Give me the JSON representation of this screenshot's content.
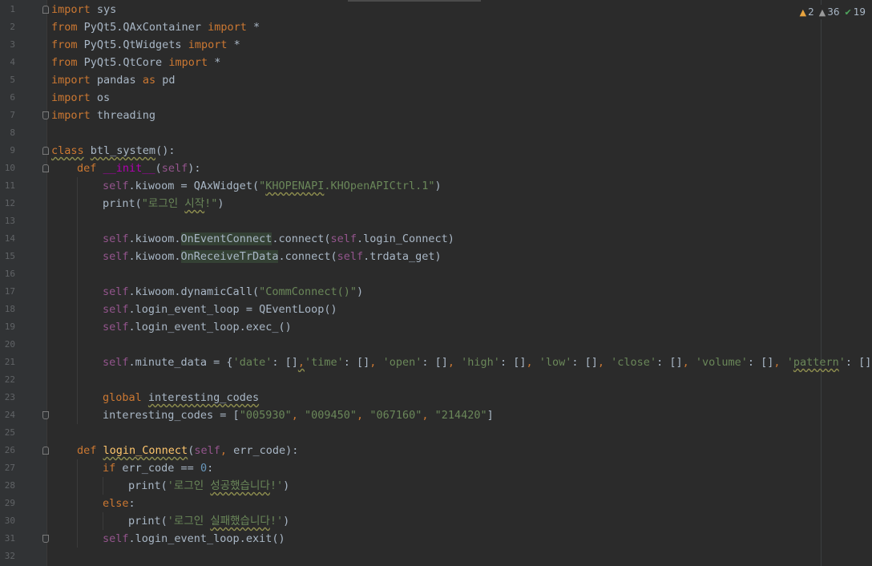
{
  "inspections": {
    "warnings": "2",
    "weak_warnings": "36",
    "typos": "19"
  },
  "colors": {
    "background": "#2b2b2b",
    "keyword": "#cc7832",
    "string": "#6a8759",
    "self": "#94558d",
    "function": "#ffc66d",
    "number": "#6897bb"
  },
  "lines": [
    {
      "n": "1",
      "fold": "start",
      "indent": 0,
      "tokens": [
        [
          "kw",
          "import"
        ],
        [
          "t",
          " sys"
        ]
      ]
    },
    {
      "n": "2",
      "indent": 0,
      "tokens": [
        [
          "kw",
          "from"
        ],
        [
          "t",
          " PyQt5.QAxContainer "
        ],
        [
          "kw",
          "import"
        ],
        [
          "t",
          " *"
        ]
      ]
    },
    {
      "n": "3",
      "indent": 0,
      "tokens": [
        [
          "kw",
          "from"
        ],
        [
          "t",
          " PyQt5.QtWidgets "
        ],
        [
          "kw",
          "import"
        ],
        [
          "t",
          " *"
        ]
      ]
    },
    {
      "n": "4",
      "indent": 0,
      "tokens": [
        [
          "kw",
          "from"
        ],
        [
          "t",
          " PyQt5.QtCore "
        ],
        [
          "kw",
          "import"
        ],
        [
          "t",
          " *"
        ]
      ]
    },
    {
      "n": "5",
      "indent": 0,
      "tokens": [
        [
          "kw",
          "import"
        ],
        [
          "t",
          " pandas "
        ],
        [
          "kw",
          "as"
        ],
        [
          "t",
          " pd"
        ]
      ]
    },
    {
      "n": "6",
      "indent": 0,
      "tokens": [
        [
          "kw",
          "import"
        ],
        [
          "t",
          " os"
        ]
      ]
    },
    {
      "n": "7",
      "fold": "end",
      "indent": 0,
      "tokens": [
        [
          "kw",
          "import"
        ],
        [
          "t",
          " threading"
        ]
      ]
    },
    {
      "n": "8",
      "indent": 0,
      "tokens": []
    },
    {
      "n": "9",
      "fold": "start",
      "indent": 0,
      "tokens": [
        [
          "kw wavy",
          "class"
        ],
        [
          "t",
          " "
        ],
        [
          "t wavy",
          "btl_system"
        ],
        [
          "t",
          "():"
        ]
      ]
    },
    {
      "n": "10",
      "fold": "start",
      "indent": 1,
      "tokens": [
        [
          "kw",
          "def "
        ],
        [
          "mag",
          "__init__"
        ],
        [
          "t",
          "("
        ],
        [
          "slf",
          "self"
        ],
        [
          "t",
          "):"
        ]
      ]
    },
    {
      "n": "11",
      "indent": 2,
      "tokens": [
        [
          "slf",
          "self"
        ],
        [
          "t",
          ".kiwoom = QAxWidget("
        ],
        [
          "str",
          "\""
        ],
        [
          "str wavy",
          "KHOPENAPI"
        ],
        [
          "str",
          ".KHOpenAPICtrl.1\""
        ],
        [
          "t",
          ")"
        ]
      ]
    },
    {
      "n": "12",
      "indent": 2,
      "tokens": [
        [
          "t",
          "print("
        ],
        [
          "str",
          "\"로그인 "
        ],
        [
          "str wavy",
          "시작"
        ],
        [
          "str",
          "!\""
        ],
        [
          "t",
          ")"
        ]
      ]
    },
    {
      "n": "13",
      "indent": 2,
      "tokens": []
    },
    {
      "n": "14",
      "indent": 2,
      "tokens": [
        [
          "slf",
          "self"
        ],
        [
          "t",
          ".kiwoom."
        ],
        [
          "t hl",
          "OnEventConnect"
        ],
        [
          "t",
          ".connect("
        ],
        [
          "slf",
          "self"
        ],
        [
          "t",
          ".login_Connect)"
        ]
      ]
    },
    {
      "n": "15",
      "indent": 2,
      "tokens": [
        [
          "slf",
          "self"
        ],
        [
          "t",
          ".kiwoom."
        ],
        [
          "t hl",
          "OnReceiveTrData"
        ],
        [
          "t",
          ".connect("
        ],
        [
          "slf",
          "self"
        ],
        [
          "t",
          ".trdata_get)"
        ]
      ]
    },
    {
      "n": "16",
      "indent": 2,
      "tokens": []
    },
    {
      "n": "17",
      "indent": 2,
      "tokens": [
        [
          "slf",
          "self"
        ],
        [
          "t",
          ".kiwoom.dynamicCall("
        ],
        [
          "str",
          "\"CommConnect()\""
        ],
        [
          "t",
          ")"
        ]
      ]
    },
    {
      "n": "18",
      "indent": 2,
      "tokens": [
        [
          "slf",
          "self"
        ],
        [
          "t",
          ".login_event_loop = QEventLoop()"
        ]
      ]
    },
    {
      "n": "19",
      "indent": 2,
      "tokens": [
        [
          "slf",
          "self"
        ],
        [
          "t",
          ".login_event_loop.exec_()"
        ]
      ]
    },
    {
      "n": "20",
      "indent": 2,
      "tokens": []
    },
    {
      "n": "21",
      "indent": 2,
      "tokens": [
        [
          "slf",
          "self"
        ],
        [
          "t",
          ".minute_data = {"
        ],
        [
          "str",
          "'date'"
        ],
        [
          "t",
          ": []"
        ],
        [
          "kw wavy",
          ","
        ],
        [
          "str",
          "'time'"
        ],
        [
          "t",
          ": []"
        ],
        [
          "kw",
          ","
        ],
        [
          "t",
          " "
        ],
        [
          "str",
          "'open'"
        ],
        [
          "t",
          ": []"
        ],
        [
          "kw",
          ","
        ],
        [
          "t",
          " "
        ],
        [
          "str",
          "'high'"
        ],
        [
          "t",
          ": []"
        ],
        [
          "kw",
          ","
        ],
        [
          "t",
          " "
        ],
        [
          "str",
          "'low'"
        ],
        [
          "t",
          ": []"
        ],
        [
          "kw",
          ","
        ],
        [
          "t",
          " "
        ],
        [
          "str",
          "'close'"
        ],
        [
          "t",
          ": []"
        ],
        [
          "kw",
          ","
        ],
        [
          "t",
          " "
        ],
        [
          "str",
          "'volume'"
        ],
        [
          "t",
          ": []"
        ],
        [
          "kw",
          ","
        ],
        [
          "t",
          " "
        ],
        [
          "str",
          "'"
        ],
        [
          "str wavy",
          "pattern"
        ],
        [
          "str",
          "'"
        ],
        [
          "t",
          ": []}"
        ]
      ]
    },
    {
      "n": "22",
      "indent": 2,
      "tokens": []
    },
    {
      "n": "23",
      "indent": 2,
      "tokens": [
        [
          "kw",
          "global "
        ],
        [
          "t wavy",
          "interesting_codes"
        ]
      ]
    },
    {
      "n": "24",
      "fold": "end",
      "indent": 2,
      "tokens": [
        [
          "t",
          "interesting_codes = ["
        ],
        [
          "str",
          "\"005930\""
        ],
        [
          "kw",
          ","
        ],
        [
          "t",
          " "
        ],
        [
          "str",
          "\"009450\""
        ],
        [
          "kw",
          ","
        ],
        [
          "t",
          " "
        ],
        [
          "str",
          "\"067160\""
        ],
        [
          "kw",
          ","
        ],
        [
          "t",
          " "
        ],
        [
          "str",
          "\"214420\""
        ],
        [
          "t",
          "]"
        ]
      ]
    },
    {
      "n": "25",
      "indent": 1,
      "tokens": []
    },
    {
      "n": "26",
      "fold": "start",
      "indent": 1,
      "tokens": [
        [
          "kw",
          "def "
        ],
        [
          "fn wavy",
          "login_Connect"
        ],
        [
          "t",
          "("
        ],
        [
          "slf",
          "self"
        ],
        [
          "kw",
          ","
        ],
        [
          "t",
          " err_code):"
        ]
      ]
    },
    {
      "n": "27",
      "indent": 2,
      "tokens": [
        [
          "kw",
          "if"
        ],
        [
          "t",
          " err_code == "
        ],
        [
          "num",
          "0"
        ],
        [
          "t",
          ":"
        ]
      ]
    },
    {
      "n": "28",
      "indent": 3,
      "tokens": [
        [
          "t",
          "print("
        ],
        [
          "str",
          "'로그인 "
        ],
        [
          "str wavy",
          "성공했습니다"
        ],
        [
          "str",
          "!'"
        ],
        [
          "t",
          ")"
        ]
      ]
    },
    {
      "n": "29",
      "indent": 2,
      "tokens": [
        [
          "kw",
          "else"
        ],
        [
          "t",
          ":"
        ]
      ]
    },
    {
      "n": "30",
      "indent": 3,
      "tokens": [
        [
          "t",
          "print("
        ],
        [
          "str",
          "'로그인 "
        ],
        [
          "str wavy",
          "실패했습니다"
        ],
        [
          "str",
          "!'"
        ],
        [
          "t",
          ")"
        ]
      ]
    },
    {
      "n": "31",
      "fold": "end",
      "indent": 2,
      "tokens": [
        [
          "slf",
          "self"
        ],
        [
          "t",
          ".login_event_loop.exit()"
        ]
      ]
    },
    {
      "n": "32",
      "indent": 0,
      "tokens": []
    }
  ]
}
